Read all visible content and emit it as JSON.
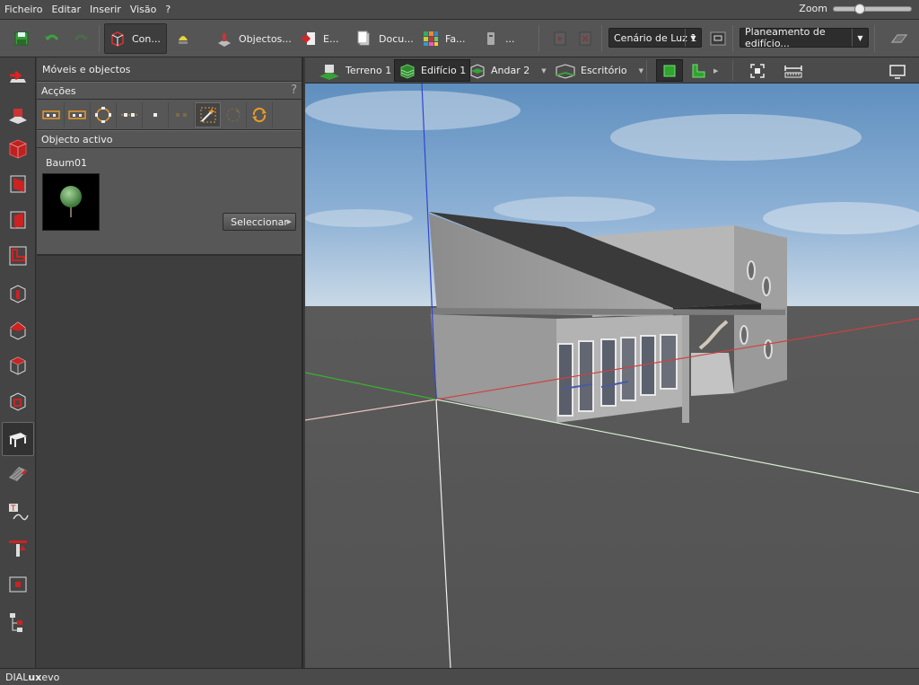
{
  "menu": {
    "items": [
      "Ficheiro",
      "Editar",
      "Inserir",
      "Visão",
      "?"
    ],
    "zoom_label": "Zoom",
    "zoom_level": 0.3
  },
  "toolbar": {
    "construction_label": "Con...",
    "objects_label": "Objectos...",
    "export_label": "E...",
    "documentation_label": "Docu...",
    "facades_label": "Fa...",
    "more_label": "...",
    "light_scene": "Cenário de Luz 1",
    "planning_mode": "Planeamento de edifício..."
  },
  "viewbar": {
    "terrain": "Terreno 1",
    "building": "Edifício 1",
    "floor": "Andar 2",
    "room": "Escritório"
  },
  "panel": {
    "title": "Móveis e objectos",
    "actions_header": "Acções",
    "help": "?",
    "active_header": "Objecto activo",
    "active_name": "Baum01",
    "select_button": "Seleccionar"
  },
  "status": {
    "brand_prefix": "DIAL",
    "brand_bold": "ux",
    "brand_suffix": "evo"
  },
  "colors": {
    "accent_red": "#c8262b",
    "axis_x": "#d04040",
    "axis_y": "#3ab030",
    "axis_z": "#3040d0"
  }
}
